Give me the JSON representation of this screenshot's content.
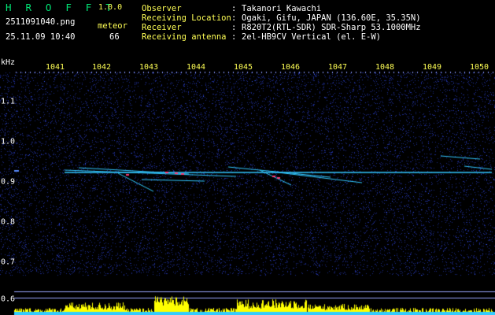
{
  "app": {
    "title": "H R O F F T",
    "version": "1.0.0"
  },
  "file": {
    "name": "2511091040.png",
    "timestamp": "25.11.09 10:40"
  },
  "meteor": {
    "label": "meteor",
    "count": "66"
  },
  "info": [
    {
      "label": "Observer",
      "sep": ":",
      "value": "Takanori Kawachi"
    },
    {
      "label": "Receiving Location",
      "sep": ":",
      "value": "Ogaki, Gifu, JAPAN (136.60E, 35.35N)"
    },
    {
      "label": "Receiver",
      "sep": ":",
      "value": "R820T2(RTL-SDR) SDR-Sharp 53.1000MHz"
    },
    {
      "label": "Receiving antenna",
      "sep": ":",
      "value": "2el-HB9CV Vertical (el. E-W)"
    }
  ],
  "axis": {
    "unit": "kHz",
    "x_ticks": [
      "1041",
      "1042",
      "1043",
      "1044",
      "1045",
      "1046",
      "1047",
      "1048",
      "1049",
      "1050"
    ],
    "y_ticks": [
      "1.1",
      "1.0",
      "0.9",
      "0.8",
      "0.7",
      "0.6"
    ]
  },
  "colors": {
    "background": "#000000",
    "noise": "#1c2a8a",
    "signal": "#32c8ff",
    "hot": "#ff3c78",
    "level": "#ffff00",
    "label_yellow": "#ffff55",
    "title_green": "#00e676"
  }
}
